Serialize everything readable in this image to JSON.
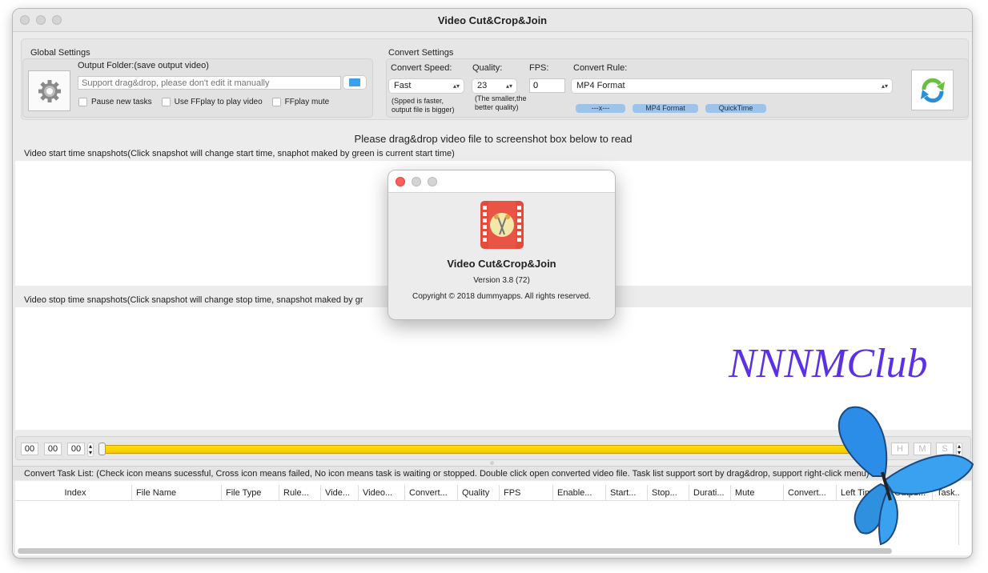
{
  "window": {
    "title": "Video Cut&Crop&Join"
  },
  "global": {
    "title": "Global Settings",
    "output_label": "Output Folder:(save output video)",
    "output_placeholder": "Support drag&drop, please don't edit it manually",
    "pause": "Pause new tasks",
    "ffplay": "Use FFplay to play video",
    "mute": "FFplay mute"
  },
  "convert": {
    "title": "Convert Settings",
    "speed_label": "Convert Speed:",
    "speed_value": "Fast",
    "speed_hint1": "(Spped is faster,",
    "speed_hint2": "output file is bigger)",
    "quality_label": "Quality:",
    "quality_value": "23",
    "quality_hint1": "(The smaller,the",
    "quality_hint2": "better quality)",
    "fps_label": "FPS:",
    "fps_value": "0",
    "rule_label": "Convert Rule:",
    "rule_value": "MP4 Format",
    "tags": [
      "---x---",
      "MP4 Format",
      "QuickTime"
    ]
  },
  "main": {
    "drop_hint": "Please drag&drop video file to screenshot box below to read",
    "start_label": "Video start time snapshots(Click snapshot will change start time, snaphot maked by green is current start time)",
    "stop_label": "Video stop time snapshots(Click snapshot will change stop time, snapshot maked by gr",
    "watermark": "NNNMClub"
  },
  "timeline": {
    "h": "00",
    "m": "00",
    "s": "00",
    "end_h": "H",
    "end_m": "M",
    "end_s": "S",
    "progress": 1.0
  },
  "tasks": {
    "label": "Convert Task List: (Check icon means sucessful,  Cross icon means failed, No icon means task is waiting or stopped. Double click open converted video file. Task list support sort by drag&drop, support right-click menu)",
    "columns": [
      "Index",
      "File Name",
      "File Type",
      "Rule...",
      "Vide...",
      "Video...",
      "Convert...",
      "Quality",
      "FPS",
      "Enable...",
      "Start...",
      "Stop...",
      "Durati...",
      "Mute",
      "Convert...",
      "Left Time",
      "Outpu...",
      "Task.."
    ]
  },
  "about": {
    "name": "Video Cut&Crop&Join",
    "version": "Version 3.8 (72)",
    "copyright": "Copyright © 2018 dummyapps. All rights reserved."
  }
}
